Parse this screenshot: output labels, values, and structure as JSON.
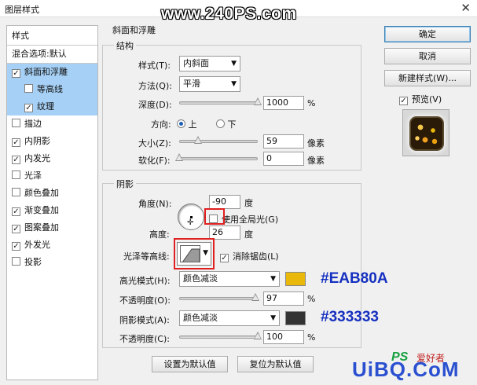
{
  "window": {
    "title": "图层样式",
    "close_glyph": "✕"
  },
  "watermark_top": "www.240PS.com",
  "sidebar": {
    "header": "样式",
    "blend_options": "混合选项:默认",
    "items": [
      {
        "label": "斜面和浮雕",
        "checked": true,
        "selected": true,
        "sub": false
      },
      {
        "label": "等高线",
        "checked": false,
        "selected": true,
        "sub": true
      },
      {
        "label": "纹理",
        "checked": true,
        "selected": true,
        "sub": true
      },
      {
        "label": "描边",
        "checked": false,
        "selected": false,
        "sub": false
      },
      {
        "label": "内阴影",
        "checked": true,
        "selected": false,
        "sub": false
      },
      {
        "label": "内发光",
        "checked": true,
        "selected": false,
        "sub": false
      },
      {
        "label": "光泽",
        "checked": false,
        "selected": false,
        "sub": false
      },
      {
        "label": "颜色叠加",
        "checked": false,
        "selected": false,
        "sub": false
      },
      {
        "label": "渐变叠加",
        "checked": true,
        "selected": false,
        "sub": false
      },
      {
        "label": "图案叠加",
        "checked": true,
        "selected": false,
        "sub": false
      },
      {
        "label": "外发光",
        "checked": true,
        "selected": false,
        "sub": false
      },
      {
        "label": "投影",
        "checked": false,
        "selected": false,
        "sub": false
      }
    ]
  },
  "bevel": {
    "group_title": "斜面和浮雕",
    "structure_title": "结构",
    "style_label": "样式(T):",
    "style_value": "内斜面",
    "technique_label": "方法(Q):",
    "technique_value": "平滑",
    "depth_label": "深度(D):",
    "depth_value": "1000",
    "depth_unit": "%",
    "depth_fraction": 1.0,
    "direction_label": "方向:",
    "dir_up": "上",
    "dir_down": "下",
    "dir_selected": "up",
    "size_label": "大小(Z):",
    "size_value": "59",
    "size_unit": "像素",
    "size_fraction": 0.24,
    "soften_label": "软化(F):",
    "soften_value": "0",
    "soften_unit": "像素",
    "soften_fraction": 0.0
  },
  "shading": {
    "title": "阴影",
    "angle_label": "角度(N):",
    "angle_value": "-90",
    "angle_unit": "度",
    "global_light_label": "使用全局光(G)",
    "global_light_checked": false,
    "altitude_label": "高度:",
    "altitude_value": "26",
    "altitude_unit": "度",
    "gloss_contour_label": "光泽等高线:",
    "anti_alias_label": "消除锯齿(L)",
    "anti_alias_checked": true,
    "highlight_mode_label": "高光模式(H):",
    "highlight_mode_value": "颜色减淡",
    "highlight_color": "#EAB80A",
    "highlight_color_text": "#EAB80A",
    "highlight_opacity_label": "不透明度(O):",
    "highlight_opacity_value": "97",
    "highlight_opacity_unit": "%",
    "highlight_opacity_fraction": 0.97,
    "shadow_mode_label": "阴影模式(A):",
    "shadow_mode_value": "颜色减淡",
    "shadow_color": "#333333",
    "shadow_color_text": "#333333",
    "shadow_opacity_label": "不透明度(C):",
    "shadow_opacity_value": "100",
    "shadow_opacity_unit": "%",
    "shadow_opacity_fraction": 1.0
  },
  "buttons": {
    "ok": "确定",
    "cancel": "取消",
    "new_style": "新建样式(W)...",
    "preview_label": "预览(V)",
    "preview_checked": true,
    "make_default": "设置为默认值",
    "reset_default": "复位为默认值"
  },
  "watermark_bottom": {
    "text": "UiBQ.CoM",
    "ps": "PS",
    "cn": "爱好者"
  }
}
